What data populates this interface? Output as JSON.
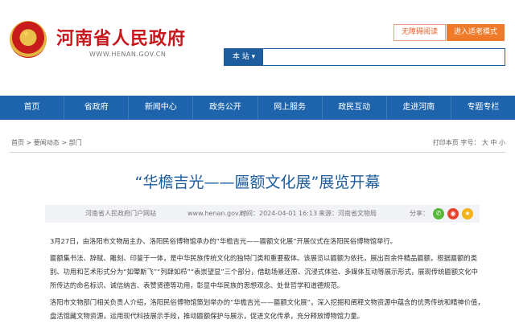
{
  "header": {
    "site_title": "河南省人民政府",
    "site_url": "WWW.HENAN.GOV.CN",
    "accessibility_label": "无障碍阅读",
    "elder_mode_label": "进入适老模式",
    "search_scope": "本 站 ▾",
    "search_placeholder": ""
  },
  "nav": {
    "items": [
      "首页",
      "省政府",
      "新闻中心",
      "政务公开",
      "网上服务",
      "政民互动",
      "走进河南",
      "专题专栏"
    ]
  },
  "breadcrumb": {
    "home": "首页",
    "sep": " > ",
    "section": "要闻动态",
    "sub": "部门"
  },
  "font_size": {
    "label": "打印本页  字号：",
    "large": "大",
    "medium": "中",
    "small": "小"
  },
  "article": {
    "title": "“华檐吉光——匾额文化展”展览开幕",
    "meta": {
      "source": "河南省人民政府门户网站",
      "url": "www.henan.gov.cn",
      "time": "时间：2024-04-01 16:13",
      "author": "来源：河南省文物局",
      "share_label": "分享："
    },
    "paragraphs": [
      "3月27日，由洛阳市文物局主办、洛阳民俗博物馆承办的“华檐吉光——匾额文化展”开展仪式在洛阳民俗博物馆举行。",
      "匾额集书法、辞赋、雕刻、印鉴于一体，是中华民族传统文化的独特门类和重要载体。该展览以匾额为依托，展出百余件精品匾额，根据匾额的类别、功用和艺术形式分为“如翚斯飞”“列肆如栉”“表崇望显”三个部分，借助场景还原、沉浸式体验、多媒体互动等展示形式，展现传统匾额文化中所传达的命名标识、诚信纳吉、表赞贤德等功用，彰显中华民族的思想观念、处世哲学和道德规范。",
      "洛阳市文物部门相关负责人介绍，洛阳民俗博物馆策划举办的“华檐吉光——匾额文化展”，深入挖掘和阐释文物资源中蕴含的优秀传统和精神价值，盘活馆藏文物资源，运用现代科技展示手段，推动匾额保护与展示，促进文化传承，充分释放博物馆力量。"
    ]
  },
  "colors": {
    "brand_red": "#c8161d",
    "nav_blue": "#1d64ad",
    "title_blue": "#1d5d9e",
    "elder_orange": "#ee7a2a"
  },
  "icons": {
    "emblem": "national-emblem-icon",
    "wechat": "wechat-icon",
    "weibo": "weibo-icon",
    "qzone": "qzone-icon"
  }
}
